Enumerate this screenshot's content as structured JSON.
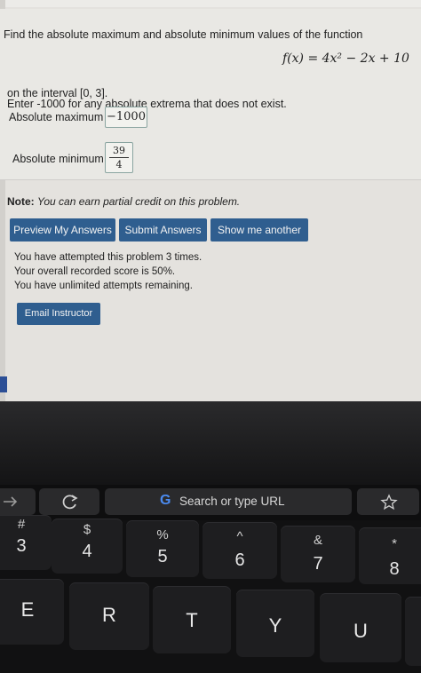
{
  "problem": {
    "prompt": "Find the absolute maximum and absolute minimum values of the function",
    "function": "f(x) = 4x² − 2x + 10",
    "interval_text": "on the interval [0, 3].",
    "instruction": "Enter -1000 for any absolute extrema that does not exist.",
    "max_label": "Absolute maximum =",
    "max_value": "−1000",
    "min_label": "Absolute minimum =",
    "min_numerator": "39",
    "min_denominator": "4"
  },
  "note": {
    "prefix": "Note:",
    "text": "You can earn partial credit on this problem."
  },
  "buttons": {
    "preview": "Preview My Answers",
    "submit": "Submit Answers",
    "another": "Show me another",
    "email": "Email Instructor"
  },
  "status": {
    "attempts": "You have attempted this problem 3 times.",
    "score": "Your overall recorded score is 50%.",
    "remaining": "You have unlimited attempts remaining."
  },
  "touchbar": {
    "search_placeholder": "Search or type URL",
    "google_glyph": "G",
    "icons": [
      "arrow-right-icon",
      "reload-icon",
      "google-icon",
      "star-icon"
    ]
  },
  "keyboard": {
    "number_row": [
      {
        "top": "#",
        "bottom": "3"
      },
      {
        "top": "$",
        "bottom": "4"
      },
      {
        "top": "%",
        "bottom": "5"
      },
      {
        "top": "^",
        "bottom": "6"
      },
      {
        "top": "&",
        "bottom": "7"
      },
      {
        "top": "*",
        "bottom": "8"
      }
    ],
    "letter_row": [
      "E",
      "R",
      "T",
      "Y",
      "U"
    ]
  },
  "colors": {
    "button_blue": "#2f5e8f",
    "page_background": "#e9e8e4",
    "keyboard_dark": "#111112"
  }
}
